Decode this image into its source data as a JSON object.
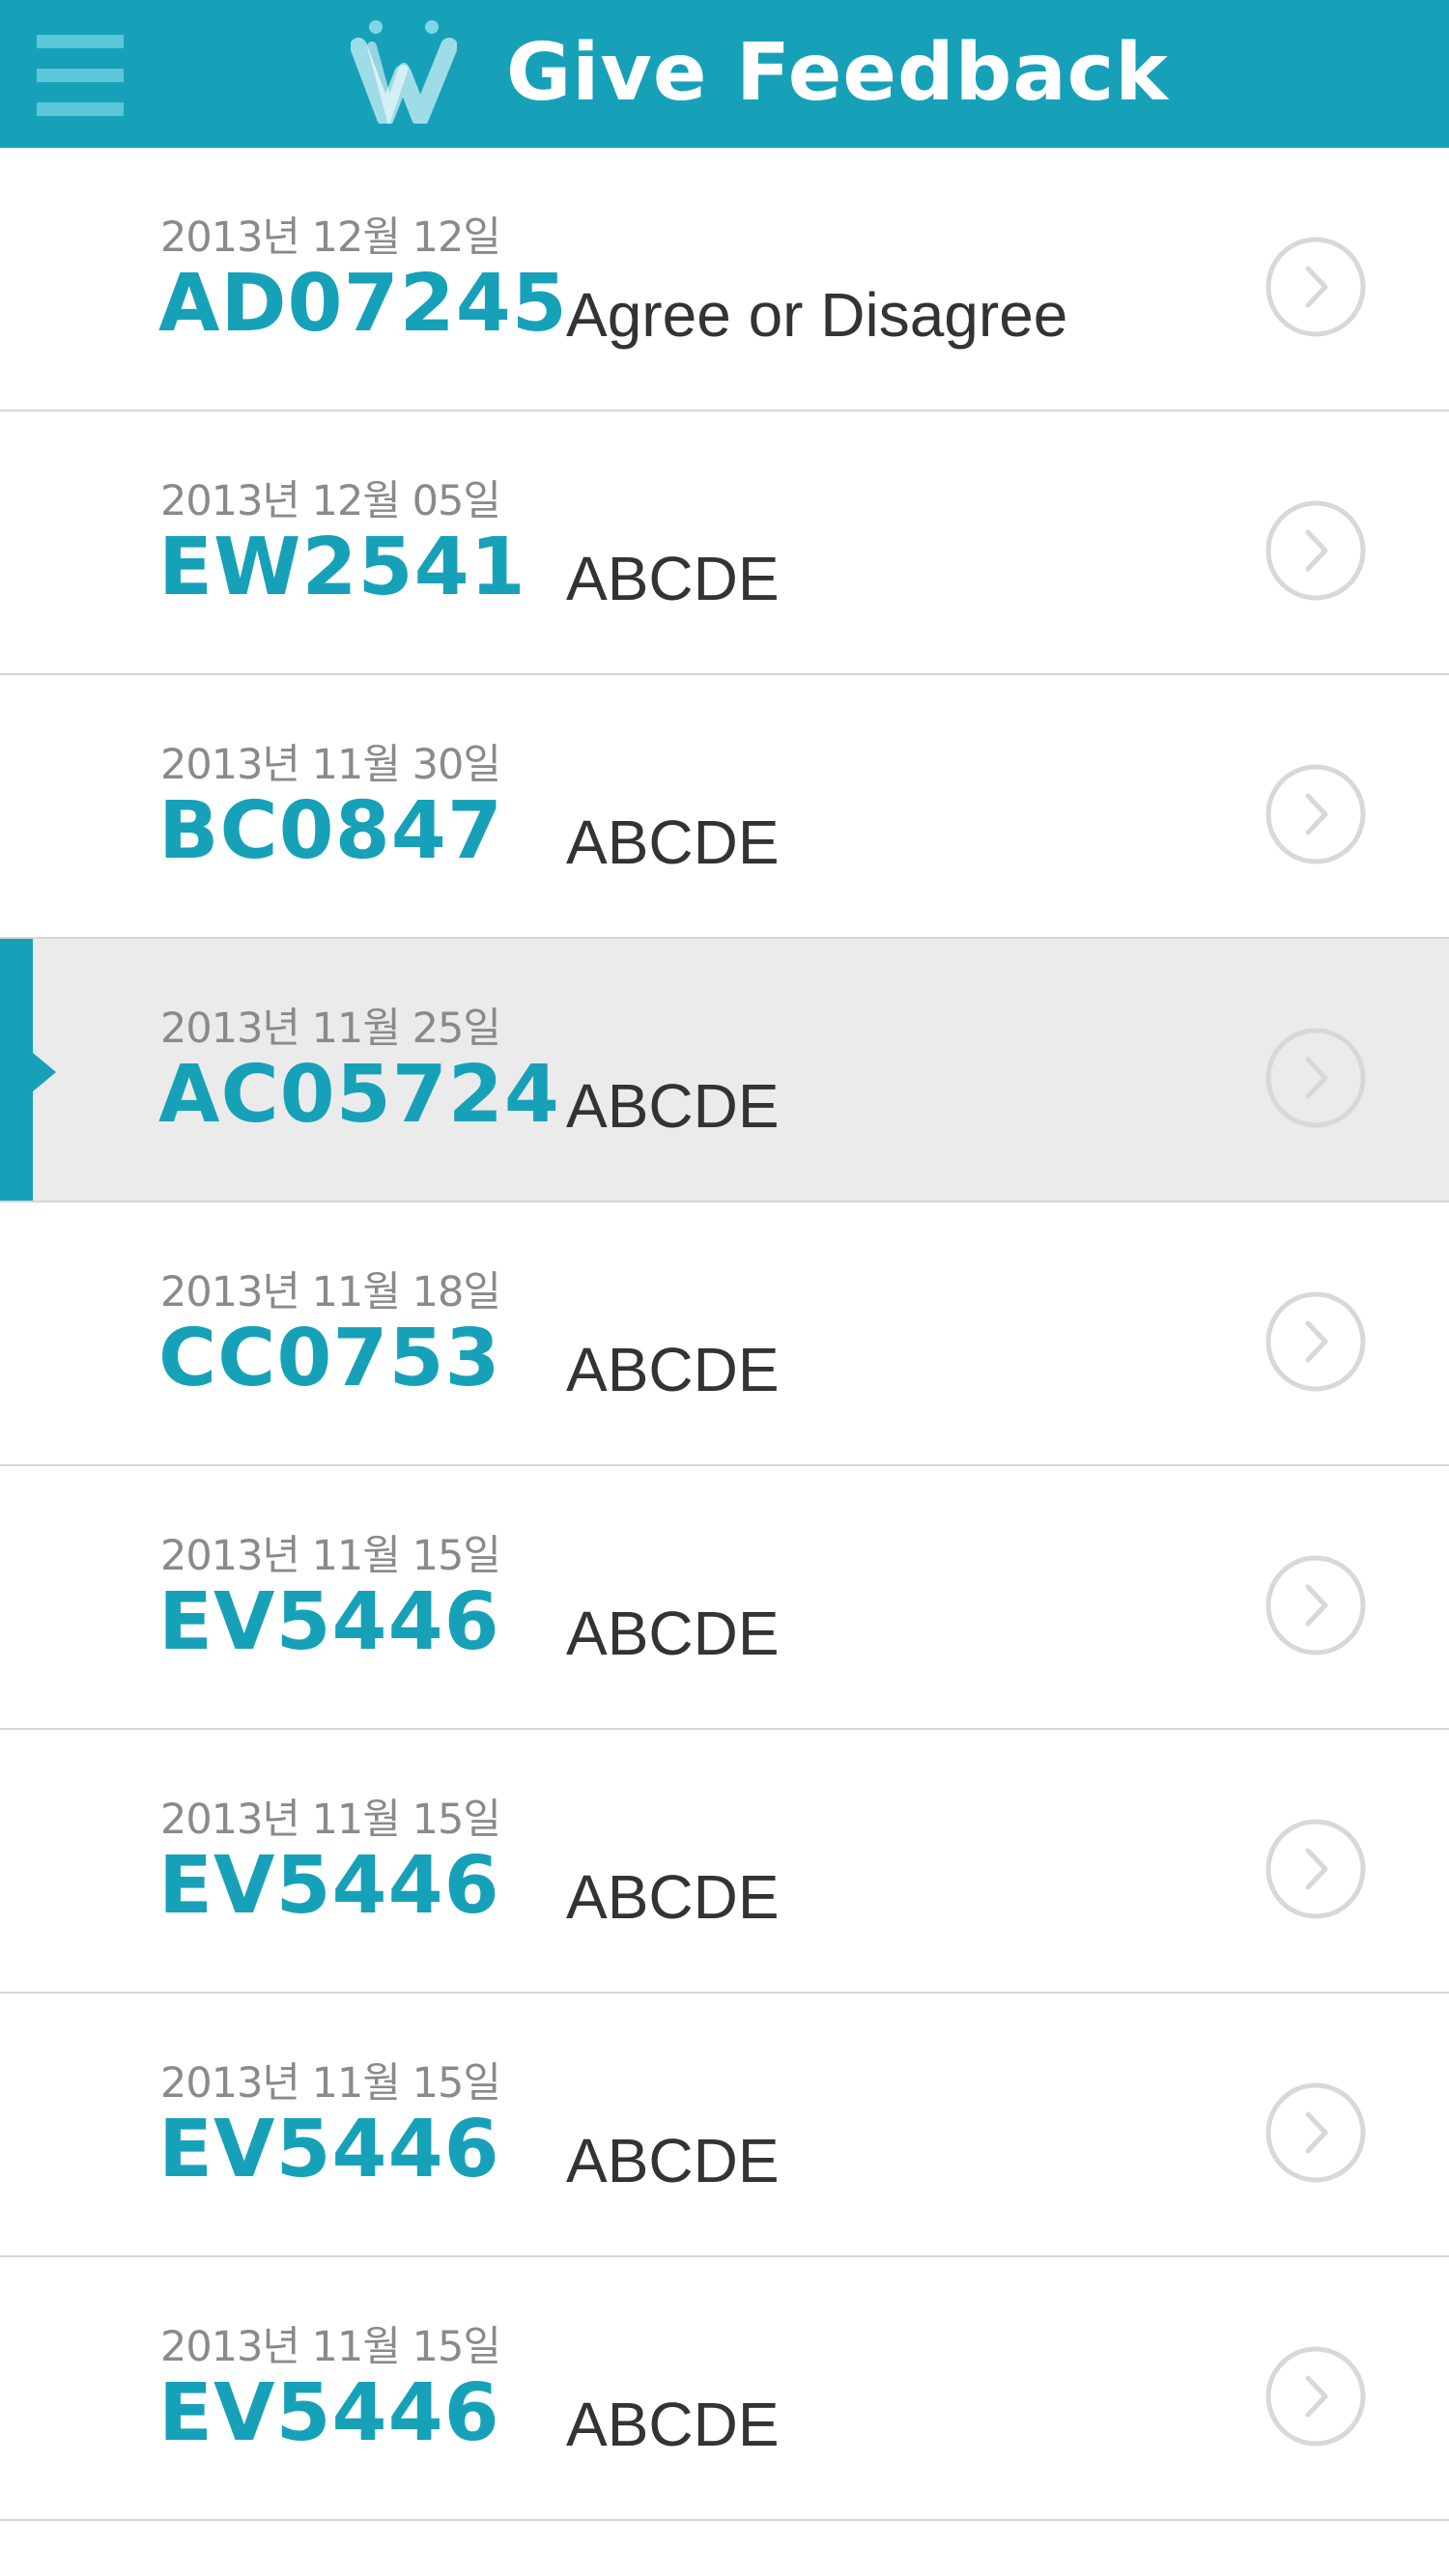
{
  "header": {
    "title": "Give Feedback",
    "background": "#17a1b9",
    "menu_icon": "hamburger-menu-icon",
    "logo_icon": "w-logo-icon"
  },
  "colors": {
    "accent": "#17a1b9",
    "date_text": "#8a8a8a",
    "label_text": "#333333",
    "selected_row": "#ebebeb",
    "divider": "#d6d6d6",
    "chevron": "#d8d8d8"
  },
  "items": [
    {
      "date": "2013년 12월 12일",
      "code": "AD07245",
      "label": "Agree or Disagree",
      "selected": false
    },
    {
      "date": "2013년 12월 05일",
      "code": "EW2541",
      "label": "ABCDE",
      "selected": false
    },
    {
      "date": "2013년 11월 30일",
      "code": "BC0847",
      "label": "ABCDE",
      "selected": false
    },
    {
      "date": "2013년 11월 25일",
      "code": "AC05724",
      "label": "ABCDE",
      "selected": true
    },
    {
      "date": "2013년 11월 18일",
      "code": "CC0753",
      "label": "ABCDE",
      "selected": false
    },
    {
      "date": "2013년 11월 15일",
      "code": "EV5446",
      "label": "ABCDE",
      "selected": false
    },
    {
      "date": "2013년 11월 15일",
      "code": "EV5446",
      "label": "ABCDE",
      "selected": false
    },
    {
      "date": "2013년 11월 15일",
      "code": "EV5446",
      "label": "ABCDE",
      "selected": false
    },
    {
      "date": "2013년 11월 15일",
      "code": "EV5446",
      "label": "ABCDE",
      "selected": false
    }
  ],
  "row_icon": "chevron-right-circle-icon"
}
